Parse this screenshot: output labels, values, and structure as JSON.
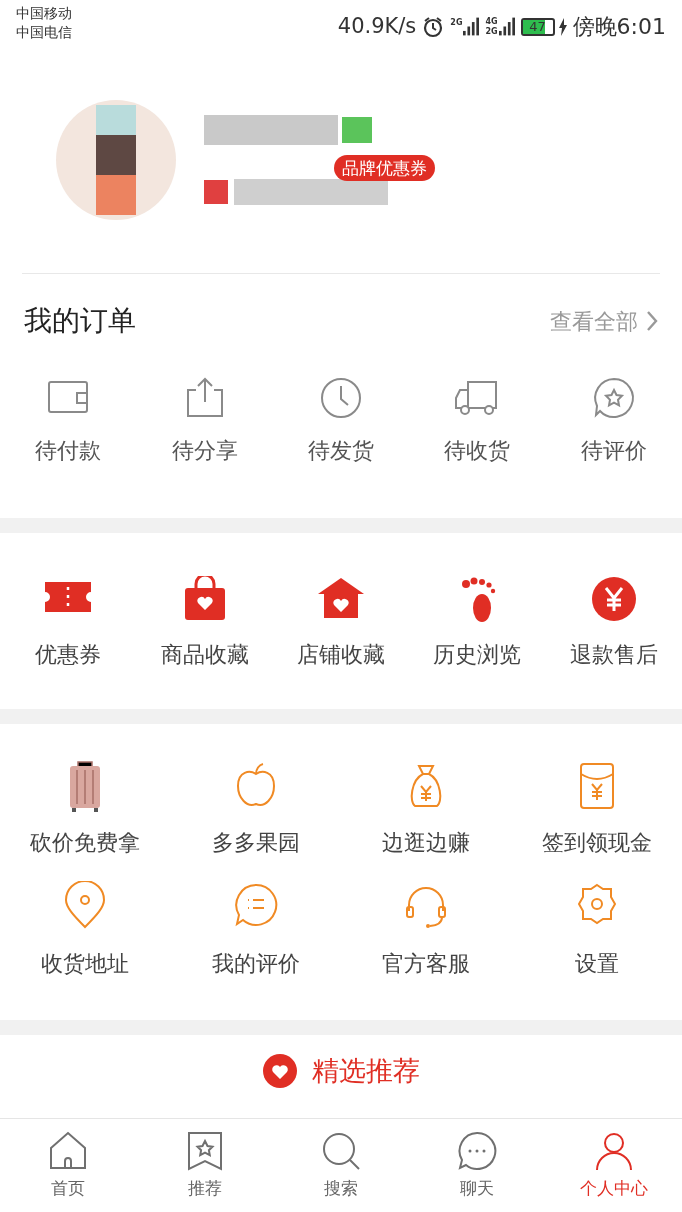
{
  "status_bar": {
    "carriers": [
      "中国移动",
      "中国电信"
    ],
    "speed": "40.9K/s",
    "signal_labels": [
      "2G",
      "4G",
      "2G"
    ],
    "battery": "47",
    "time": "傍晚6:01"
  },
  "profile": {
    "badge": "品牌优惠券"
  },
  "orders": {
    "title": "我的订单",
    "view_all": "查看全部",
    "items": [
      "待付款",
      "待分享",
      "待发货",
      "待收货",
      "待评价"
    ]
  },
  "shortcuts": [
    "优惠券",
    "商品收藏",
    "店铺收藏",
    "历史浏览",
    "退款售后"
  ],
  "services": [
    "砍价免费拿",
    "多多果园",
    "边逛边赚",
    "签到领现金",
    "收货地址",
    "我的评价",
    "官方客服",
    "设置"
  ],
  "recommend": {
    "title": "精选推荐"
  },
  "tab_bar": [
    {
      "label": "首页",
      "selected": false
    },
    {
      "label": "推荐",
      "selected": false
    },
    {
      "label": "搜索",
      "selected": false
    },
    {
      "label": "聊天",
      "selected": false
    },
    {
      "label": "个人中心",
      "selected": true
    }
  ]
}
